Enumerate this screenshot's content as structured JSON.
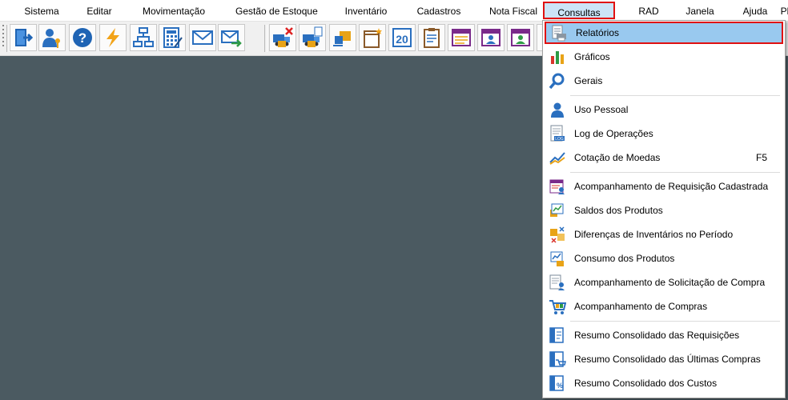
{
  "menubar": {
    "items": [
      {
        "label": "Sistema",
        "icon": ""
      },
      {
        "label": "Editar"
      },
      {
        "label": "Movimentação"
      },
      {
        "label": "Gestão de Estoque"
      },
      {
        "label": "Inventário"
      },
      {
        "label": "Cadastros"
      },
      {
        "label": "Nota Fiscal"
      },
      {
        "label": "Consultas"
      },
      {
        "label": "RAD"
      },
      {
        "label": "Janela"
      },
      {
        "label": "Ajuda"
      },
      {
        "label": "Pl"
      }
    ],
    "active": "Consultas"
  },
  "toolbar": {
    "buttons": [
      "exit-door-icon",
      "user-key-icon",
      "help-icon",
      "lightning-icon",
      "org-chart-icon",
      "calculator-icon",
      "envelope-icon",
      "send-mail-icon",
      "truck-cancel-icon",
      "truck-document-icon",
      "box-transfer-icon",
      "calendar-star-icon",
      "calendar-date-icon",
      "clipboard-report-icon",
      "report-list-icon",
      "user-report-icon",
      "user-report-2-icon"
    ]
  },
  "dropdown": {
    "items": [
      {
        "label": "Relatórios",
        "icon": "printer-report-icon",
        "shortcut": ""
      },
      {
        "label": "Gráficos",
        "icon": "bar-chart-icon",
        "shortcut": ""
      },
      {
        "label": "Gerais",
        "icon": "magnifier-icon",
        "shortcut": ""
      },
      {
        "label": "Uso Pessoal",
        "icon": "person-icon",
        "shortcut": ""
      },
      {
        "label": "Log de Operações",
        "icon": "log-document-icon",
        "shortcut": ""
      },
      {
        "label": "Cotação de Moedas",
        "icon": "currency-chart-icon",
        "shortcut": "F5"
      },
      {
        "label": "Acompanhamento de Requisição Cadastrada",
        "icon": "requisition-icon",
        "shortcut": ""
      },
      {
        "label": "Saldos dos Produtos",
        "icon": "product-balance-icon",
        "shortcut": ""
      },
      {
        "label": "Diferenças de Inventários no Período",
        "icon": "inventory-diff-icon",
        "shortcut": ""
      },
      {
        "label": "Consumo dos Produtos",
        "icon": "consumption-chart-icon",
        "shortcut": ""
      },
      {
        "label": "Acompanhamento de Solicitação de Compra",
        "icon": "purchase-request-icon",
        "shortcut": ""
      },
      {
        "label": "Acompanhamento de Compras",
        "icon": "shopping-cart-icon",
        "shortcut": ""
      },
      {
        "label": "Resumo Consolidado das Requisições",
        "icon": "summary-requisitions-icon",
        "shortcut": ""
      },
      {
        "label": "Resumo Consolidado das Últimas Compras",
        "icon": "summary-purchases-icon",
        "shortcut": ""
      },
      {
        "label": "Resumo Consolidado dos Custos",
        "icon": "summary-costs-icon",
        "shortcut": ""
      }
    ]
  },
  "colors": {
    "workspace": "#4b5a61",
    "highlight": "#99c9ef",
    "annotation": "#e01010"
  }
}
